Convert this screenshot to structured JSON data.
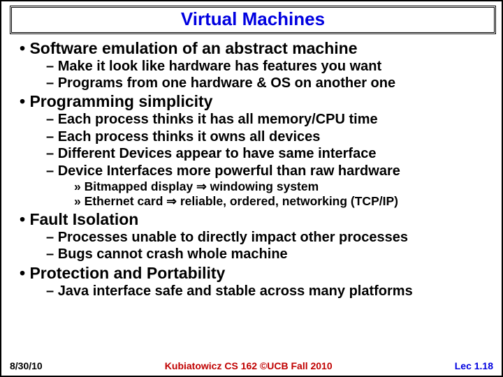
{
  "title": "Virtual Machines",
  "b1": "Software emulation of an abstract machine",
  "b1s1": "Make it look like hardware has features you want",
  "b1s2": "Programs from one hardware & OS on another one",
  "b2": "Programming simplicity",
  "b2s1": "Each process thinks it has all memory/CPU time",
  "b2s2": "Each process thinks it owns all devices",
  "b2s3": "Different Devices appear to have same interface",
  "b2s4": "Device Interfaces more powerful than raw hardware",
  "b2s4a_pre": "Bitmapped display ",
  "b2s4a_post": " windowing system",
  "b2s4b_pre": "Ethernet card ",
  "b2s4b_post": " reliable, ordered, networking (TCP/IP)",
  "b3": "Fault Isolation",
  "b3s1": "Processes unable to directly impact other processes",
  "b3s2": "Bugs cannot crash whole machine",
  "b4": "Protection and Portability",
  "b4s1": "Java interface safe and stable across many platforms",
  "footer_date": "8/30/10",
  "footer_center": "Kubiatowicz CS 162 ©UCB Fall 2010",
  "footer_page": "Lec 1.18",
  "glyph_bullet": "•",
  "glyph_dash": "–",
  "glyph_sub": "»",
  "glyph_arrow": "⇒"
}
